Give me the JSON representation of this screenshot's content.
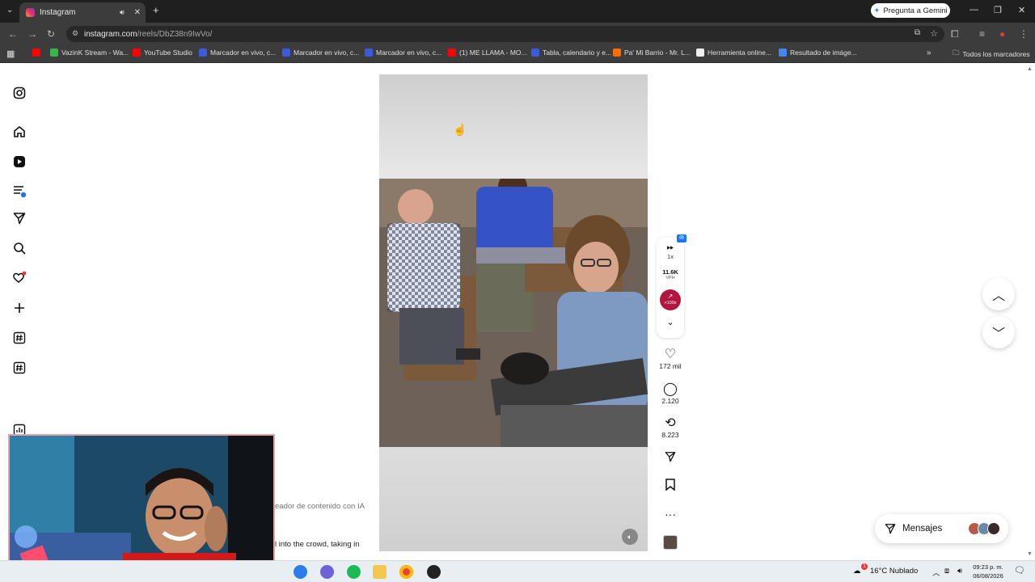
{
  "browser": {
    "tab_title": "Instagram",
    "gemini_label": "Pregunta a Gemini",
    "url_host": "instagram.com",
    "url_path": "/reels/DbZ38n9IwVo/",
    "bookmarks": [
      {
        "label": "VazinK Stream - Wa...",
        "color": "#39b54a"
      },
      {
        "label": "YouTube Studio",
        "color": "#ff0000"
      },
      {
        "label": "Marcador en vivo, c...",
        "color": "#3b5bdb"
      },
      {
        "label": "Marcador en vivo, c...",
        "color": "#3b5bdb"
      },
      {
        "label": "Marcador en vivo, c...",
        "color": "#3b5bdb"
      },
      {
        "label": "(1) ME LLAMA - MO...",
        "color": "#ff0000"
      },
      {
        "label": "Tabla, calendario y e...",
        "color": "#3b5bdb"
      },
      {
        "label": "Pa' Mi Barrio - Mr. L...",
        "color": "#ff6d00"
      },
      {
        "label": "Herramienta online...",
        "color": "#eeeeee"
      },
      {
        "label": "Resultado de imáge...",
        "color": "#4285f4"
      }
    ],
    "all_bookmarks": "Todos los marcadores"
  },
  "sidebar": {
    "icons": [
      "instagram-logo-icon",
      "home-icon",
      "reels-icon",
      "feed-icon",
      "direct-icon",
      "search-icon",
      "heart-icon",
      "create-icon",
      "hashtag-icon",
      "hashtag-icon",
      "stats-icon"
    ]
  },
  "reel": {
    "speed": "1x",
    "vph_value": "11.6K",
    "vph_label": "VPH",
    "trend_label": ">100x",
    "likes": "172 mil",
    "comments": "2.120",
    "reposts": "8.223",
    "caption_partial_1": "eador de contenido con IA",
    "caption_partial_2": "l into the crowd, taking in"
  },
  "messages": {
    "label": "Mensajes"
  },
  "taskbar": {
    "weather": "16°C  Nublado",
    "time": "09:23 p. m.",
    "date": "06/08/2026",
    "weather_badge": "1"
  },
  "colors": {
    "accent_trend": "#b0163f",
    "badge_blue": "#1877f2",
    "notif_red": "#ff3040"
  }
}
